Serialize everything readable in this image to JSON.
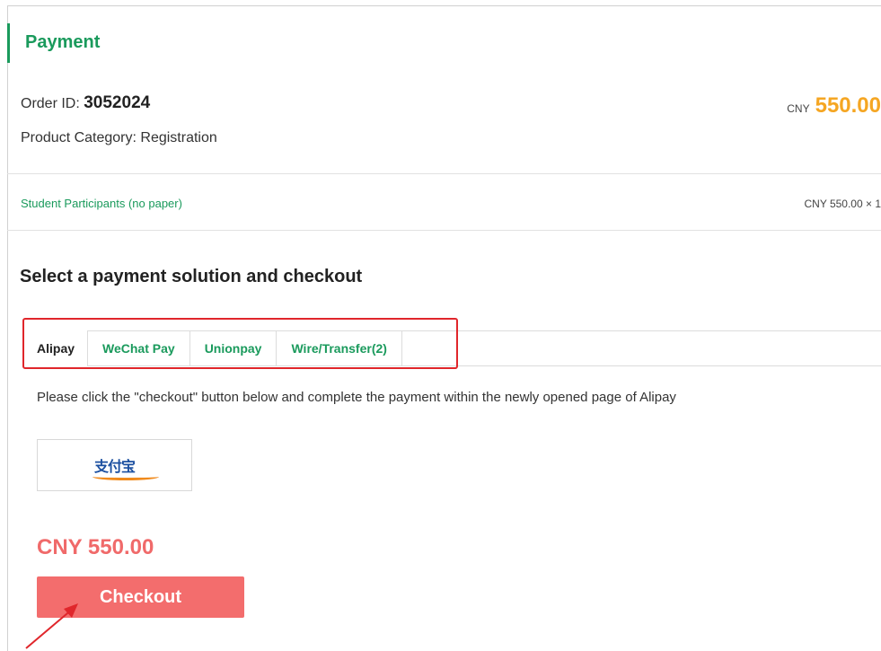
{
  "header": {
    "title": "Payment"
  },
  "order": {
    "id_label": "Order ID: ",
    "id_value": "3052024",
    "category_text": "Product Category:  Registration",
    "currency": "CNY",
    "amount": "550.00"
  },
  "line_items": [
    {
      "name": "Student Participants (no paper)",
      "price_text": "CNY 550.00 × 1"
    }
  ],
  "payment": {
    "heading": "Select a payment solution and checkout",
    "tabs": [
      {
        "label": "Alipay",
        "active": true
      },
      {
        "label": "WeChat Pay",
        "active": false
      },
      {
        "label": "Unionpay",
        "active": false
      },
      {
        "label": "Wire/Transfer(2)",
        "active": false
      }
    ],
    "instruction": "Please click the \"checkout\" button below and complete the payment within the newly opened page of Alipay",
    "method_logo": "支付宝",
    "method_logo_icon": "alipay-logo",
    "total": "CNY 550.00",
    "checkout_label": "Checkout"
  },
  "colors": {
    "brand_green": "#1a9a5c",
    "amount_orange": "#f5a623",
    "total_red": "#f06a6a",
    "button_red": "#f36d6d",
    "highlight_red": "#e0262b"
  }
}
